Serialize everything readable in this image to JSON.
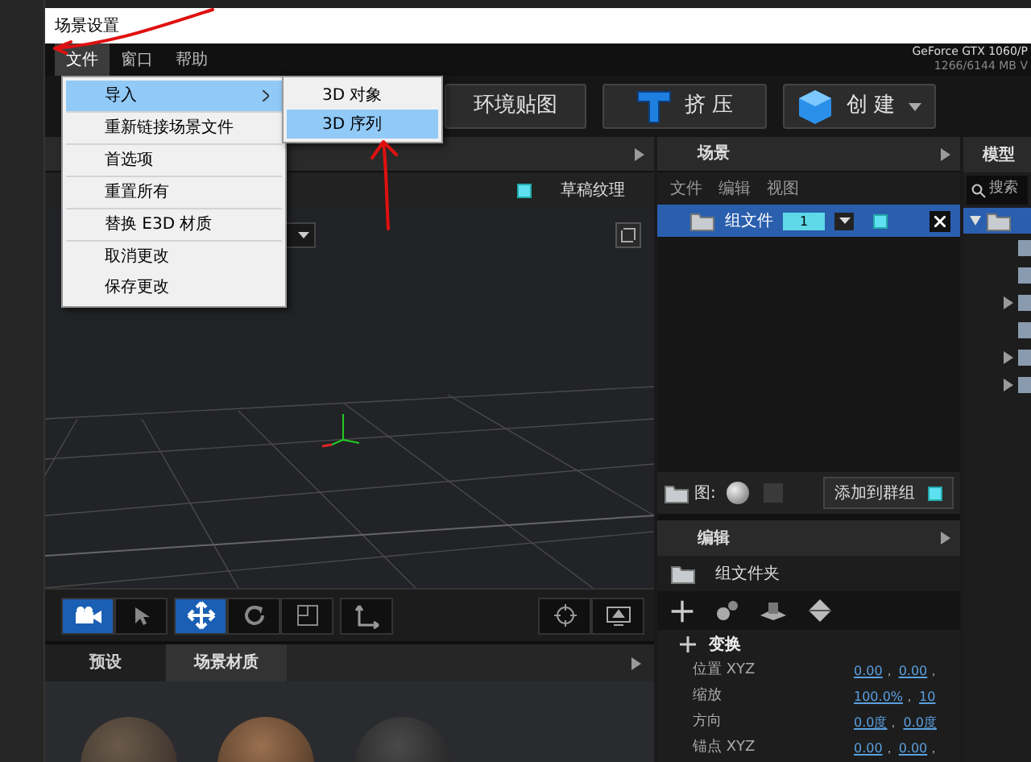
{
  "window": {
    "title": "场景设置"
  },
  "menu_bar": [
    {
      "label": "文件",
      "selected": true
    },
    {
      "label": "窗口",
      "selected": false
    },
    {
      "label": "帮助",
      "selected": false
    }
  ],
  "gpu_info": [
    "GeForce GTX 1060/P",
    "1266/6144 MB V"
  ],
  "toolbar": [
    {
      "label": "环境贴图",
      "kind": "plain",
      "dropdown": false
    },
    {
      "label": "挤 压",
      "kind": "extrude",
      "dropdown": false
    },
    {
      "label": "创 建",
      "kind": "cube",
      "dropdown": true
    }
  ],
  "file_menu": [
    {
      "label": "导入",
      "selected": true,
      "submenu": true,
      "divider_after": true
    },
    {
      "label": "重新链接场景文件",
      "selected": false,
      "submenu": false,
      "divider_after": true
    },
    {
      "label": "首选项",
      "selected": false,
      "submenu": false,
      "divider_after": true
    },
    {
      "label": "重置所有",
      "selected": false,
      "submenu": false,
      "divider_after": true
    },
    {
      "label": "替换 E3D 材质",
      "selected": false,
      "submenu": false,
      "divider_after": true
    },
    {
      "label": "取消更改",
      "selected": false,
      "submenu": false,
      "divider_after": false
    },
    {
      "label": "保存更改",
      "selected": false,
      "submenu": false,
      "divider_after": false
    }
  ],
  "submenu": [
    {
      "label": "3D 对象",
      "selected": false
    },
    {
      "label": "3D 序列",
      "selected": true
    }
  ],
  "viewport": {
    "texture_label": "草稿纹理",
    "tools": [
      {
        "selected": true
      },
      {
        "selected": false
      },
      {
        "selected": true
      },
      {
        "selected": false
      },
      {
        "selected": false
      },
      {
        "selected": false
      }
    ]
  },
  "presets_panel": {
    "tabs": [
      {
        "label": "预设",
        "selected": false
      },
      {
        "label": "场景材质",
        "selected": true
      }
    ]
  },
  "scene_panel": {
    "title": "场景",
    "menus": [
      "文件",
      "编辑",
      "视图"
    ],
    "rows": [
      {
        "name": "组文件",
        "count": "1",
        "selected": true
      }
    ],
    "map_label": "图:",
    "add_to_group": "添加到群组"
  },
  "edit_panel": {
    "title": "编辑",
    "folder": "组文件夹",
    "section": "变换",
    "properties": [
      {
        "label": "位置 XYZ",
        "values": [
          {
            "text": "0.00",
            "sep": "，"
          },
          {
            "text": "0.00",
            "sep": "，"
          }
        ]
      },
      {
        "label": "缩放",
        "values": [
          {
            "text": "100.0%",
            "sep": "，"
          },
          {
            "text": "10"
          }
        ]
      },
      {
        "label": "方向",
        "values": [
          {
            "text": "0.0度",
            "sep": "，"
          },
          {
            "text": "0.0度"
          }
        ]
      },
      {
        "label": "锚点 XYZ",
        "values": [
          {
            "text": "0.00",
            "sep": "，"
          },
          {
            "text": "0.00",
            "sep": "，"
          }
        ]
      }
    ]
  },
  "model_browser": {
    "title": "模型",
    "search_placeholder": "搜索",
    "root": {
      "expanded": true,
      "selected": true,
      "children": [
        {
          "expandable": false
        },
        {
          "expandable": false
        },
        {
          "expandable": true
        },
        {
          "expandable": false
        },
        {
          "expandable": true
        },
        {
          "expandable": true
        }
      ]
    }
  }
}
